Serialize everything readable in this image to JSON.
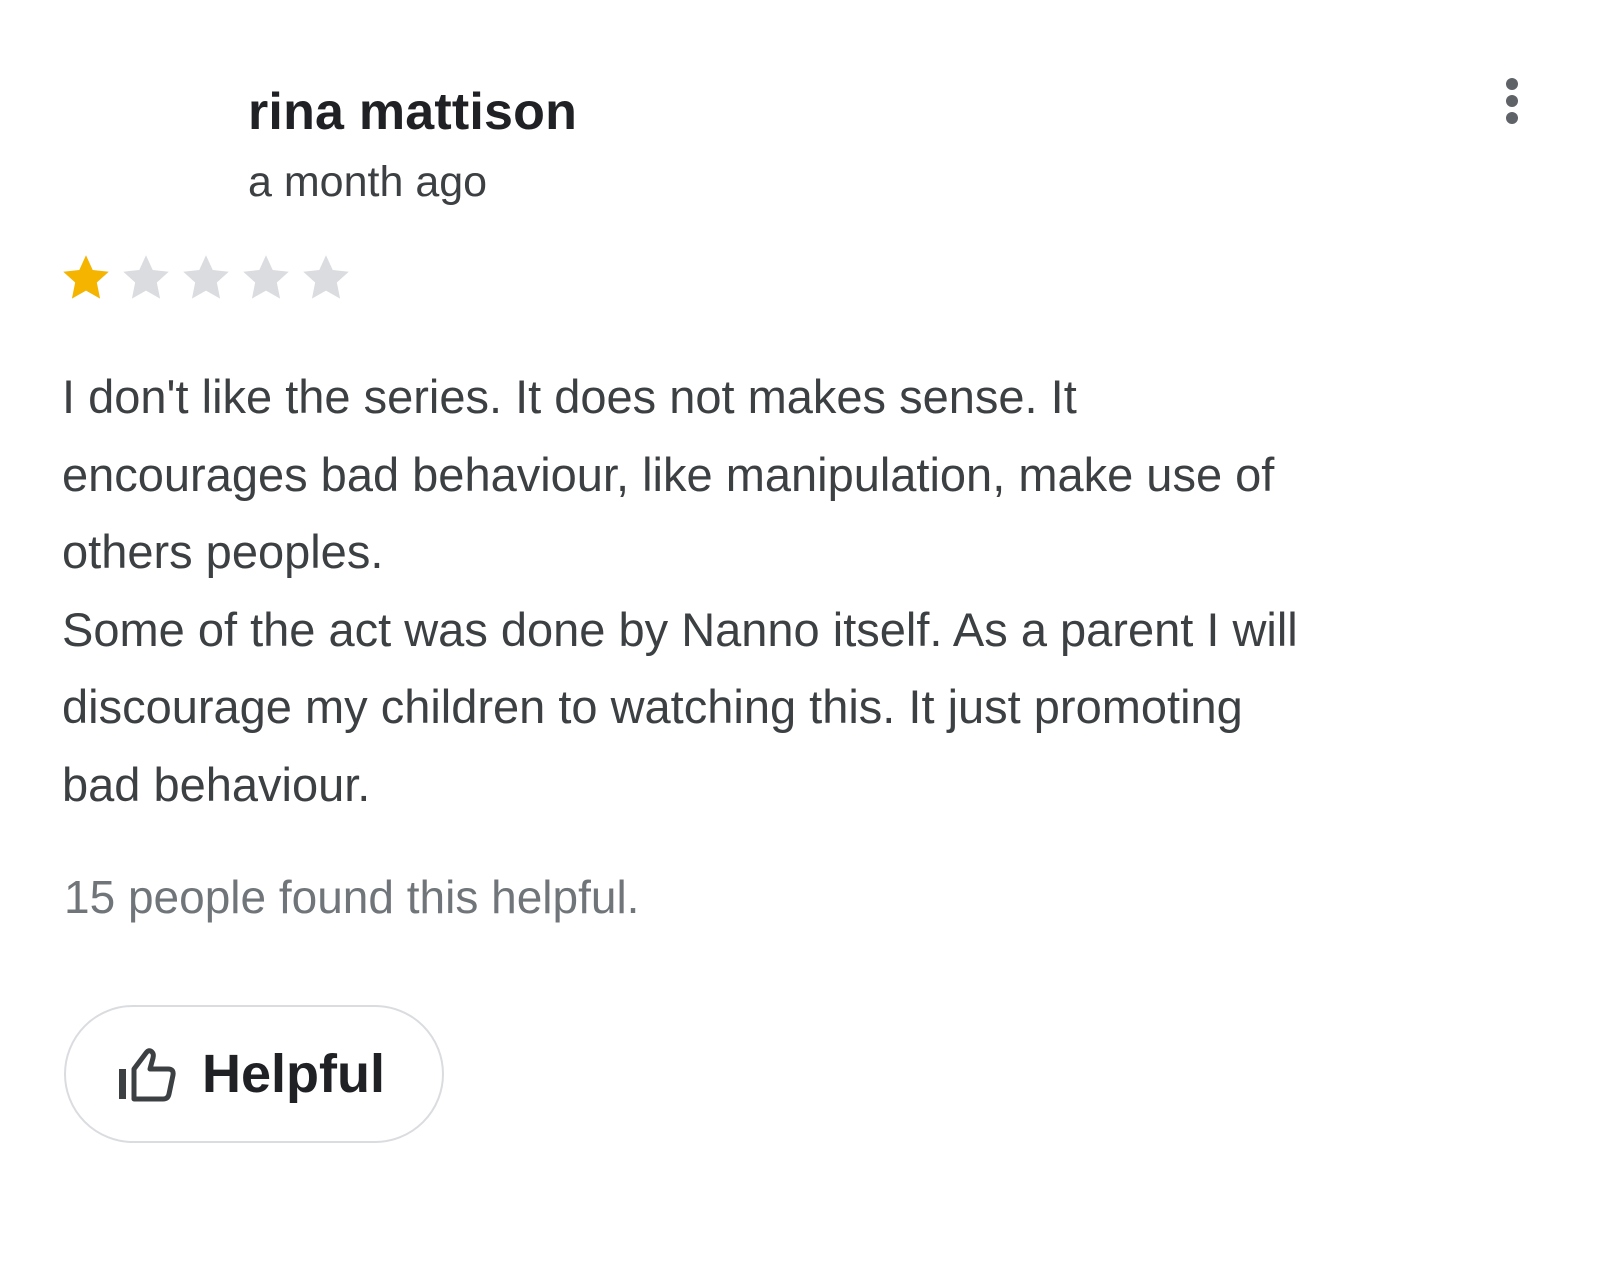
{
  "review": {
    "author": "rina mattison",
    "date": "a month ago",
    "rating": 1,
    "rating_max": 5,
    "paragraphs": [
      "I don't like the series. It does not makes sense. It\nencourages bad behaviour, like manipulation, make use of\nothers peoples.",
      "Some of the act was done by Nanno itself. As a parent I will\ndiscourage my children to watching this. It just promoting\nbad behaviour."
    ],
    "helpful_count_text": "15 people found this helpful.",
    "helpful_button_label": "Helpful"
  },
  "icons": {
    "more": "more-vert-icon",
    "helpful": "thumbs-up-icon",
    "star": "star-icon"
  },
  "colors": {
    "star_filled": "#F4B400",
    "star_empty": "#DADCE0",
    "text_primary": "#202124",
    "text_secondary": "#3C4043",
    "text_muted": "#70757A",
    "border": "#DADCE0"
  }
}
